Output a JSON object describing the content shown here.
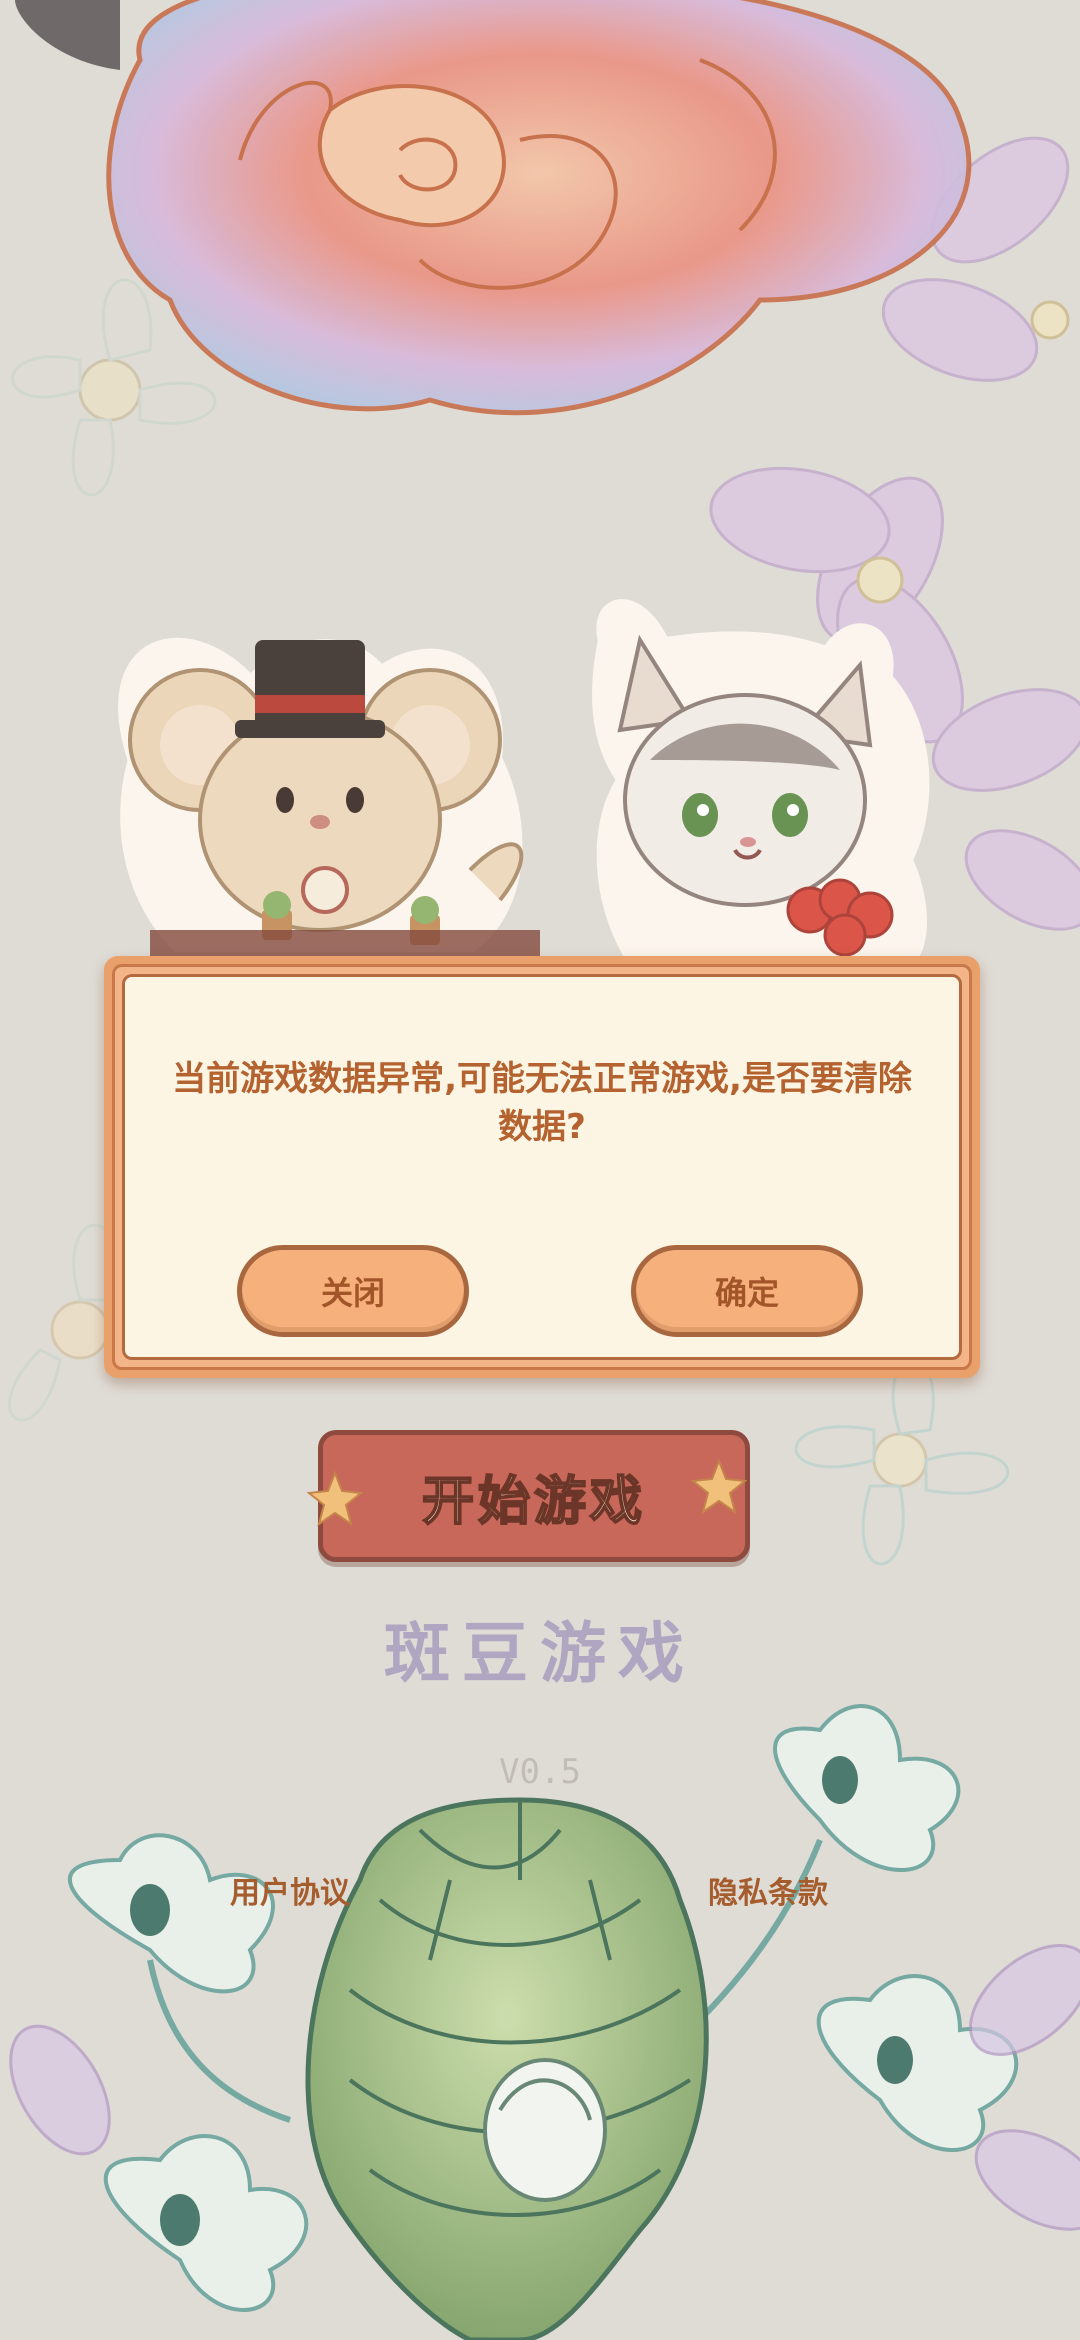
{
  "dialog": {
    "message": "当前游戏数据异常,可能无法正常游戏,是否要清除数据?",
    "close_label": "关闭",
    "confirm_label": "确定"
  },
  "start_button": {
    "label": "开始游戏"
  },
  "brand": {
    "name": "斑豆游戏"
  },
  "version": "V0.5",
  "links": {
    "user_agreement": "用户协议",
    "privacy_policy": "隐私条款"
  },
  "colors": {
    "dialog_text": "#b4622f",
    "button_fill": "#f5b07c",
    "start_button_fill": "#c8685a",
    "brand_text": "#b0a6c2"
  }
}
